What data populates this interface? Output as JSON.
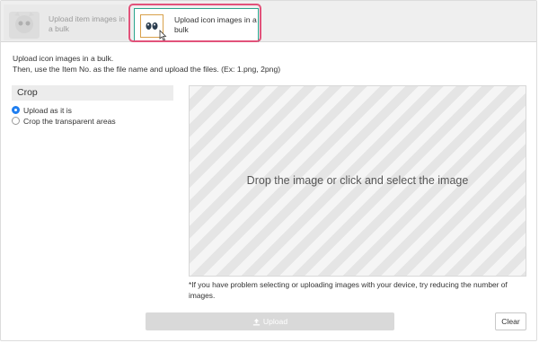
{
  "tabs": [
    {
      "label": "Upload item images in a bulk",
      "active": false
    },
    {
      "label": "Upload icon images in a bulk",
      "active": true
    }
  ],
  "description": {
    "line1": "Upload icon images in a bulk.",
    "line2": "Then, use the Item No. as the file name and upload the files. (Ex: 1.png, 2png)"
  },
  "crop": {
    "title": "Crop",
    "options": [
      {
        "label": "Upload as it is",
        "selected": true
      },
      {
        "label": "Crop the transparent areas",
        "selected": false
      }
    ]
  },
  "dropzone": {
    "text": "Drop the image or click and select the image"
  },
  "note": "*If you have problem selecting or uploading images with your device, try reducing the number of images.",
  "buttons": {
    "upload": "Upload",
    "clear": "Clear"
  },
  "colors": {
    "highlight": "#e2527a",
    "active_tab_border": "#2aa58d",
    "radio_selected": "#1f7ef0"
  }
}
